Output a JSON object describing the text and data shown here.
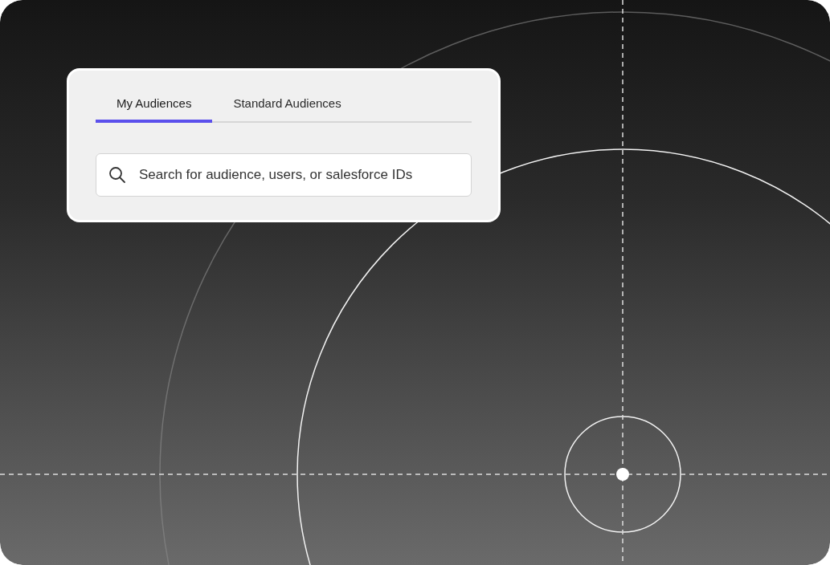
{
  "tabs": [
    {
      "label": "My Audiences",
      "selected": true
    },
    {
      "label": "Standard Audiences",
      "selected": false
    }
  ],
  "search": {
    "placeholder": "Search for audience, users, or salesforce IDs"
  }
}
